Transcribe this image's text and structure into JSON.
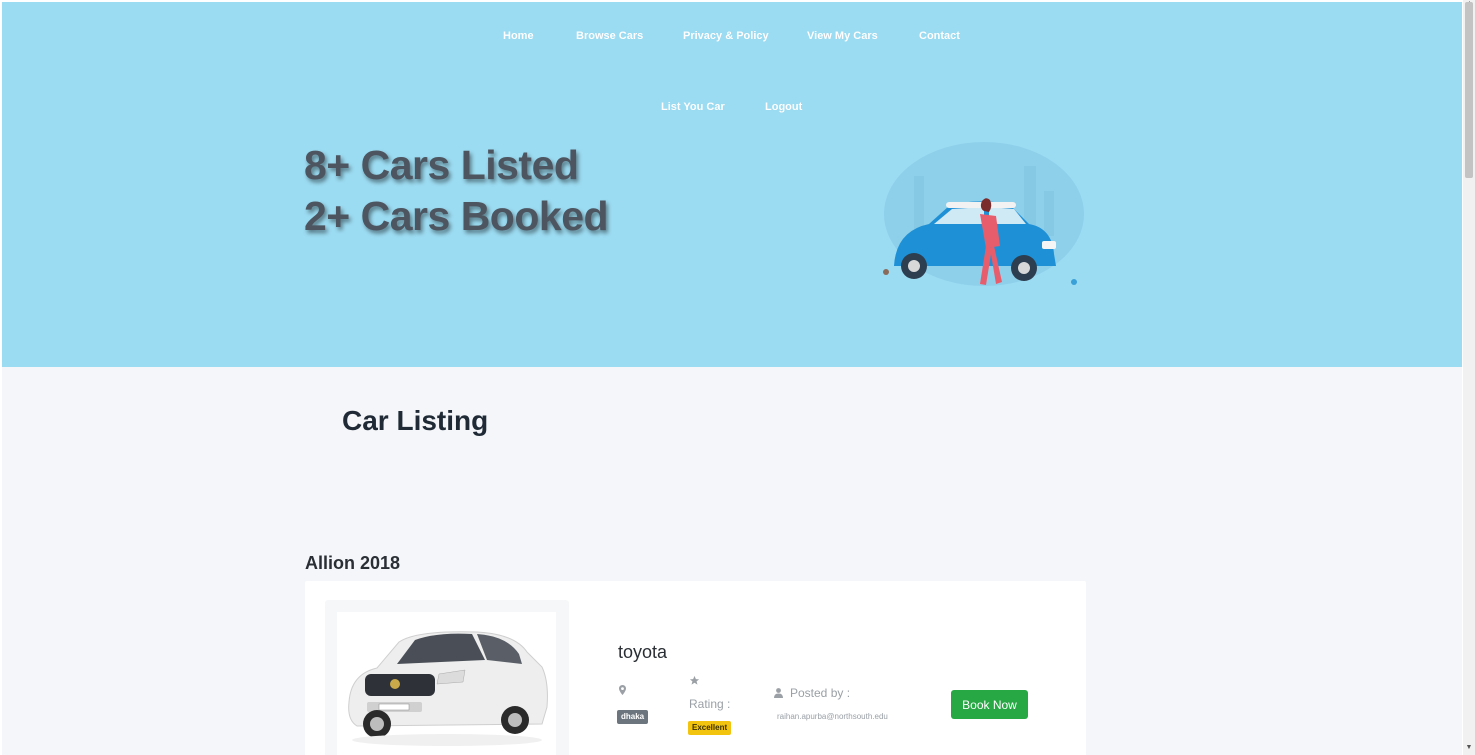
{
  "nav": {
    "items": [
      {
        "label": "Home"
      },
      {
        "label": "Browse Cars"
      },
      {
        "label": "Privacy & Policy"
      },
      {
        "label": "View My Cars"
      },
      {
        "label": "Contact"
      },
      {
        "label": "List You Car"
      },
      {
        "label": "Logout"
      }
    ]
  },
  "hero": {
    "stat_listed": "8+ Cars Listed",
    "stat_booked": "2+ Cars Booked",
    "illustration_icon": "woman-leaning-on-car-illustration"
  },
  "listing": {
    "section_title": "Car Listing",
    "cars": [
      {
        "name": "Allion 2018",
        "brand": "toyota",
        "location": "dhaka",
        "rating_label": "Rating :",
        "rating_value": "Excellent",
        "posted_by_label": "Posted by :",
        "posted_by_email": "raihan.apurba@northsouth.edu",
        "book_label": "Book Now",
        "image_icon": "white-sedan-image"
      }
    ]
  },
  "colors": {
    "hero_bg": "#9cdcf2",
    "page_bg": "#f4f6f9",
    "book_button": "#28a745",
    "rating_badge": "#f2c40f",
    "location_badge": "#6c757d"
  }
}
